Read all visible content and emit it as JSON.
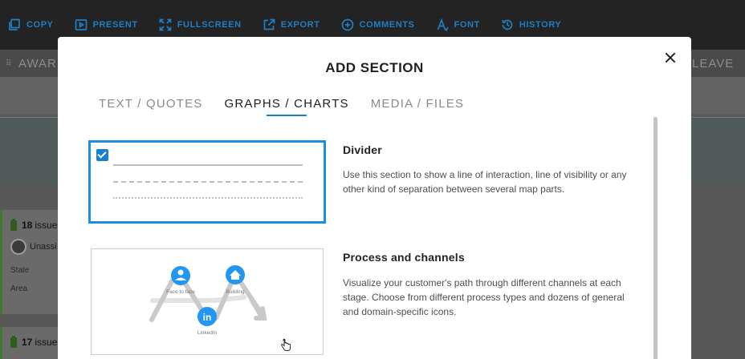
{
  "toolbar": {
    "items": [
      {
        "label": "COPY",
        "icon": "copy-icon"
      },
      {
        "label": "PRESENT",
        "icon": "present-icon"
      },
      {
        "label": "FULLSCREEN",
        "icon": "fullscreen-icon"
      },
      {
        "label": "EXPORT",
        "icon": "export-icon"
      },
      {
        "label": "COMMENTS",
        "icon": "comments-icon"
      },
      {
        "label": "FONT",
        "icon": "font-icon"
      },
      {
        "label": "HISTORY",
        "icon": "history-icon"
      }
    ],
    "color": "#1f7fc4"
  },
  "background": {
    "left_title": "AWARE",
    "right_title": "LEAVE",
    "cards": [
      {
        "issues_count": "18",
        "issues_label": "issue",
        "assignee": "Unassi",
        "state_label": "State",
        "area_label": "Area"
      },
      {
        "issues_count": "17",
        "issues_label": "issue"
      }
    ]
  },
  "modal": {
    "title": "ADD SECTION",
    "tabs": [
      {
        "label": "TEXT / QUOTES",
        "active": false
      },
      {
        "label": "GRAPHS / CHARTS",
        "active": true
      },
      {
        "label": "MEDIA / FILES",
        "active": false
      }
    ],
    "accent": "#1b7fd1",
    "sections": [
      {
        "title": "Divider",
        "description": "Use this section to show a line of interaction, line of visibility or any other kind of separation between several map parts.",
        "selected": true
      },
      {
        "title": "Process and channels",
        "description": "Visualize your customer's path through different channels at each stage. Choose from different process types and dozens of general and domain-specific icons.",
        "selected": false,
        "preview_labels": [
          "Face to face",
          "Building",
          "LinkedIn"
        ]
      }
    ]
  }
}
